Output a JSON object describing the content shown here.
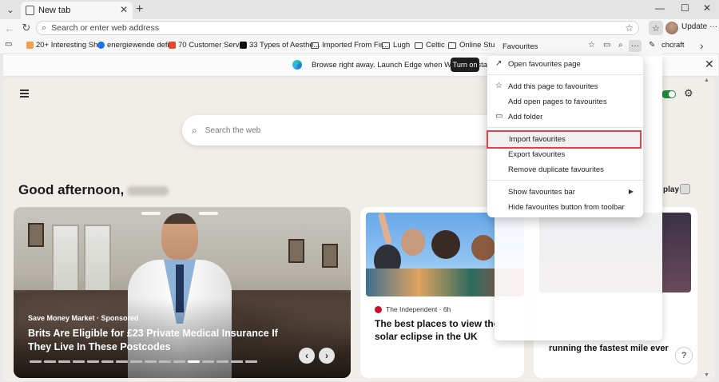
{
  "tabs": [
    {
      "title": "New tab"
    }
  ],
  "window": {
    "minimize": "—",
    "maximize": "☐",
    "close": "✕"
  },
  "address_bar": {
    "placeholder": "Search or enter web address"
  },
  "toolbar": {
    "update_label": "Update",
    "more": "···"
  },
  "bookmarks": [
    {
      "label": "20+ Interesting Sh...",
      "color": "#f0a04b"
    },
    {
      "label": "energiewende defi...",
      "color": "#1a73e8"
    },
    {
      "label": "70 Customer Servi...",
      "color": "#e8482c"
    },
    {
      "label": "33 Types of Aesthe...",
      "color": "#111111"
    },
    {
      "label": "Imported From Fir...",
      "folder": true
    },
    {
      "label": "Lugh",
      "folder": true
    },
    {
      "label": "Celtic",
      "folder": true
    },
    {
      "label": "Online Study",
      "folder": true
    }
  ],
  "bookmarks_overflow": "chcraft",
  "banner": {
    "text": "Browse right away. Launch Edge when Windows starts.",
    "button": "Turn on"
  },
  "ntp": {
    "search_placeholder": "Search the web",
    "greeting": "Good afternoon,",
    "play_label": "play",
    "hero": {
      "sponsor": "Save Money Market · Sponsored",
      "title": "Brits Are Eligible for £23 Private Medical Insurance If They Live In These Postcodes",
      "prev": "‹",
      "next": "›"
    },
    "cards": [
      {
        "source": "The Independent · 6h",
        "title": "The best places to view the solar eclipse in the UK",
        "source_color": "#c8102e"
      },
      {
        "title": "running the fastest mile ever"
      }
    ],
    "help": "?"
  },
  "favourites": {
    "title": "Favourites",
    "menu": [
      {
        "label": "Open favourites page",
        "icon": "open-external-icon"
      },
      {
        "label": "Add this page to favourites",
        "icon": "star-add-icon"
      },
      {
        "label": "Add open pages to favourites"
      },
      {
        "label": "Add folder",
        "icon": "folder-add-icon"
      },
      {
        "label": "Import favourites",
        "highlighted": true
      },
      {
        "label": "Export favourites"
      },
      {
        "label": "Remove duplicate favourites"
      },
      {
        "label": "Show favourites bar",
        "submenu": true
      },
      {
        "label": "Hide favourites button from toolbar"
      }
    ]
  },
  "colors": {
    "highlight_outline": "#e0424d",
    "toggle_on": "#1f8a3a"
  }
}
